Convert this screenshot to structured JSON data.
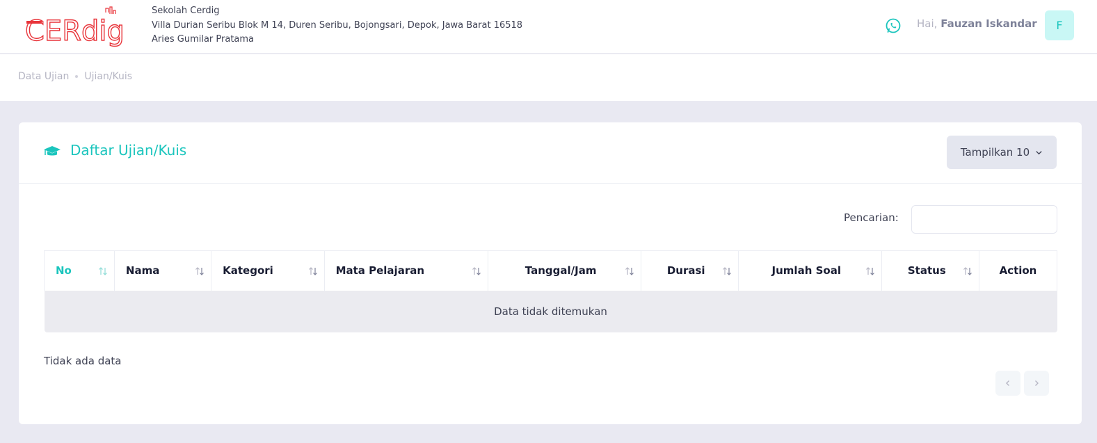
{
  "header": {
    "logo_text": "CERdig",
    "school_name": "Sekolah Cerdig",
    "school_address": "Villa Durian Seribu Blok M 14, Duren Seribu, Bojongsari, Depok, Jawa Barat 16518",
    "school_head": "Aries Gumilar Pratama",
    "greeting_prefix": "Hai,",
    "user_name": "Fauzan Iskandar",
    "avatar_initial": "F",
    "icons": {
      "whatsapp": "whatsapp-icon"
    }
  },
  "breadcrumb": {
    "items": [
      "Data Ujian",
      "Ujian/Kuis"
    ]
  },
  "card": {
    "title": "Daftar Ujian/Kuis",
    "title_icon": "graduation-cap-icon",
    "length_button": "Tampilkan 10",
    "search_label": "Pencarian:",
    "search_value": ""
  },
  "table": {
    "columns": [
      "No",
      "Nama",
      "Kategori",
      "Mata Pelajaran",
      "Tanggal/Jam",
      "Durasi",
      "Jumlah Soal",
      "Status",
      "Action"
    ],
    "empty_message": "Data tidak ditemukan",
    "info": "Tidak ada data"
  },
  "colors": {
    "accent": "#1bc5bd",
    "logo_red": "#e8343a",
    "page_bg": "#e9e9f2"
  }
}
